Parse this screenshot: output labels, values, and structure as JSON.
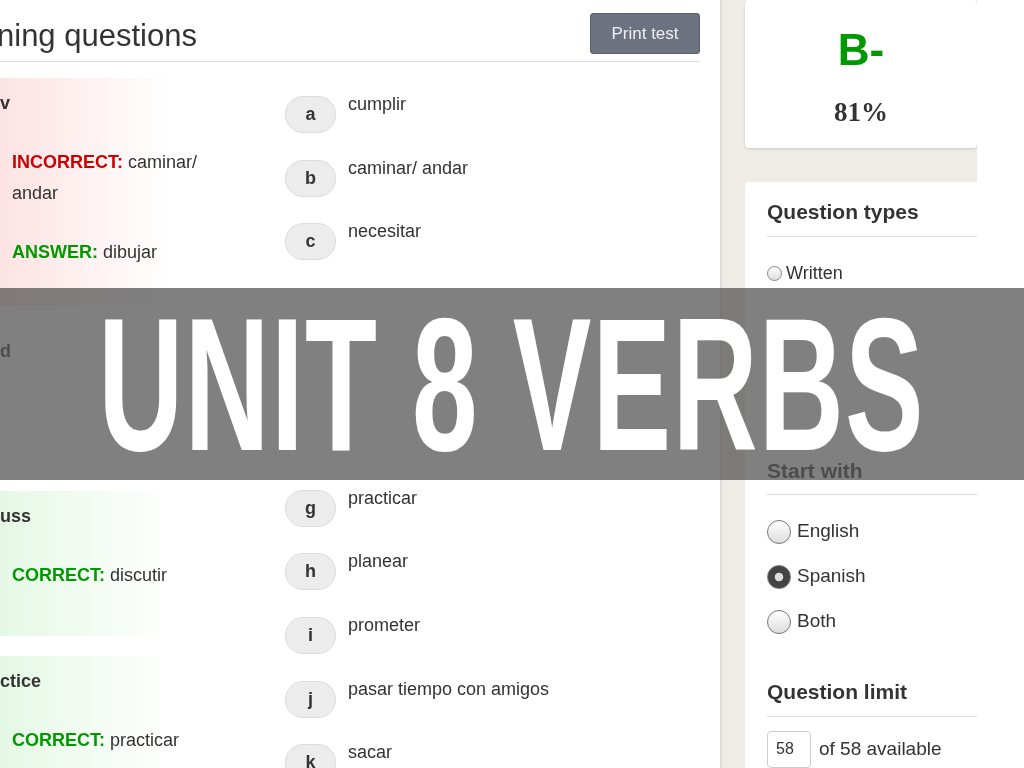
{
  "overlay": {
    "title": "UNIT 8 VERBS"
  },
  "test": {
    "title": "ning questions",
    "print_button": "Print test",
    "questions": [
      {
        "prompt": "v",
        "correct": false,
        "results": [
          {
            "correct": false,
            "text": "**INCORRECT:** caminar/ andar"
          },
          {
            "correct": true,
            "text": "**ANSWER:** dibujar"
          }
        ]
      },
      {
        "prompt": "d"
      },
      {
        "prompt": "uss",
        "correct": true,
        "results": [
          {
            "correct": true,
            "text": "**CORRECT:** discutir"
          }
        ]
      },
      {
        "prompt": "ctice",
        "correct": true,
        "results": [
          {
            "correct": true,
            "text": "**CORRECT:** practicar"
          }
        ]
      }
    ],
    "options_above": [
      {
        "letter": "a",
        "text": "cumplir"
      },
      {
        "letter": "b",
        "text": "caminar/ andar"
      },
      {
        "letter": "c",
        "text": "necesitar"
      }
    ],
    "options_below": [
      {
        "letter": "g",
        "text": "practicar"
      },
      {
        "letter": "h",
        "text": "planear"
      },
      {
        "letter": "i",
        "text": "prometer"
      },
      {
        "letter": "j",
        "text": "pasar tiempo con amigos"
      },
      {
        "letter": "k",
        "text": "sacar"
      }
    ]
  },
  "score": {
    "grade": "B-",
    "percent": "81%"
  },
  "options": {
    "question_types": {
      "heading": "Question types",
      "items": [
        {
          "label": "Written",
          "checked": false
        }
      ]
    },
    "start_with": {
      "heading": "Start with",
      "items": [
        {
          "label": "English",
          "selected": false
        },
        {
          "label": "Spanish",
          "selected": true
        },
        {
          "label": "Both",
          "selected": false
        }
      ]
    },
    "question_limit": {
      "heading": "Question limit",
      "value": "58",
      "suffix": "of 58 available"
    }
  }
}
